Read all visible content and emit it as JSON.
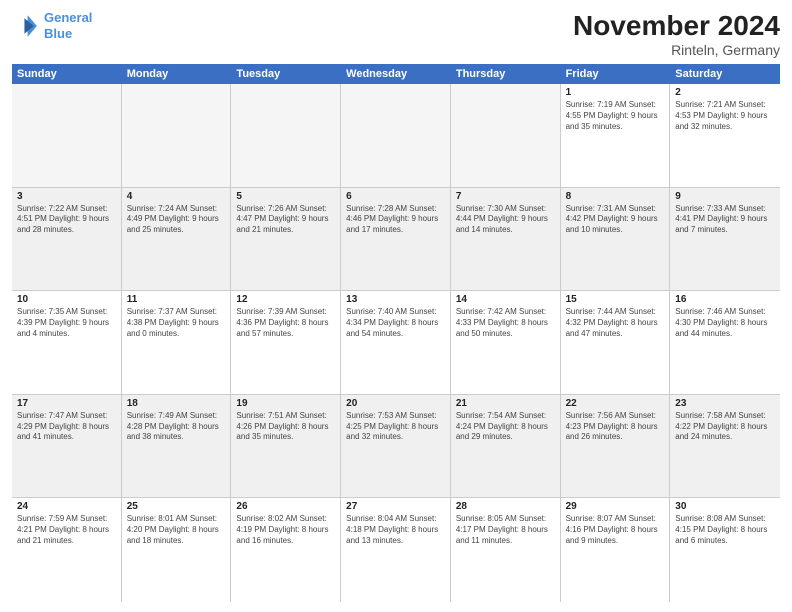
{
  "header": {
    "logo_line1": "General",
    "logo_line2": "Blue",
    "title": "November 2024",
    "location": "Rinteln, Germany"
  },
  "calendar": {
    "days_of_week": [
      "Sunday",
      "Monday",
      "Tuesday",
      "Wednesday",
      "Thursday",
      "Friday",
      "Saturday"
    ],
    "weeks": [
      [
        {
          "day": "",
          "info": "",
          "empty": true
        },
        {
          "day": "",
          "info": "",
          "empty": true
        },
        {
          "day": "",
          "info": "",
          "empty": true
        },
        {
          "day": "",
          "info": "",
          "empty": true
        },
        {
          "day": "",
          "info": "",
          "empty": true
        },
        {
          "day": "1",
          "info": "Sunrise: 7:19 AM\nSunset: 4:55 PM\nDaylight: 9 hours and 35 minutes.",
          "empty": false
        },
        {
          "day": "2",
          "info": "Sunrise: 7:21 AM\nSunset: 4:53 PM\nDaylight: 9 hours and 32 minutes.",
          "empty": false
        }
      ],
      [
        {
          "day": "3",
          "info": "Sunrise: 7:22 AM\nSunset: 4:51 PM\nDaylight: 9 hours and 28 minutes.",
          "empty": false
        },
        {
          "day": "4",
          "info": "Sunrise: 7:24 AM\nSunset: 4:49 PM\nDaylight: 9 hours and 25 minutes.",
          "empty": false
        },
        {
          "day": "5",
          "info": "Sunrise: 7:26 AM\nSunset: 4:47 PM\nDaylight: 9 hours and 21 minutes.",
          "empty": false
        },
        {
          "day": "6",
          "info": "Sunrise: 7:28 AM\nSunset: 4:46 PM\nDaylight: 9 hours and 17 minutes.",
          "empty": false
        },
        {
          "day": "7",
          "info": "Sunrise: 7:30 AM\nSunset: 4:44 PM\nDaylight: 9 hours and 14 minutes.",
          "empty": false
        },
        {
          "day": "8",
          "info": "Sunrise: 7:31 AM\nSunset: 4:42 PM\nDaylight: 9 hours and 10 minutes.",
          "empty": false
        },
        {
          "day": "9",
          "info": "Sunrise: 7:33 AM\nSunset: 4:41 PM\nDaylight: 9 hours and 7 minutes.",
          "empty": false
        }
      ],
      [
        {
          "day": "10",
          "info": "Sunrise: 7:35 AM\nSunset: 4:39 PM\nDaylight: 9 hours and 4 minutes.",
          "empty": false
        },
        {
          "day": "11",
          "info": "Sunrise: 7:37 AM\nSunset: 4:38 PM\nDaylight: 9 hours and 0 minutes.",
          "empty": false
        },
        {
          "day": "12",
          "info": "Sunrise: 7:39 AM\nSunset: 4:36 PM\nDaylight: 8 hours and 57 minutes.",
          "empty": false
        },
        {
          "day": "13",
          "info": "Sunrise: 7:40 AM\nSunset: 4:34 PM\nDaylight: 8 hours and 54 minutes.",
          "empty": false
        },
        {
          "day": "14",
          "info": "Sunrise: 7:42 AM\nSunset: 4:33 PM\nDaylight: 8 hours and 50 minutes.",
          "empty": false
        },
        {
          "day": "15",
          "info": "Sunrise: 7:44 AM\nSunset: 4:32 PM\nDaylight: 8 hours and 47 minutes.",
          "empty": false
        },
        {
          "day": "16",
          "info": "Sunrise: 7:46 AM\nSunset: 4:30 PM\nDaylight: 8 hours and 44 minutes.",
          "empty": false
        }
      ],
      [
        {
          "day": "17",
          "info": "Sunrise: 7:47 AM\nSunset: 4:29 PM\nDaylight: 8 hours and 41 minutes.",
          "empty": false
        },
        {
          "day": "18",
          "info": "Sunrise: 7:49 AM\nSunset: 4:28 PM\nDaylight: 8 hours and 38 minutes.",
          "empty": false
        },
        {
          "day": "19",
          "info": "Sunrise: 7:51 AM\nSunset: 4:26 PM\nDaylight: 8 hours and 35 minutes.",
          "empty": false
        },
        {
          "day": "20",
          "info": "Sunrise: 7:53 AM\nSunset: 4:25 PM\nDaylight: 8 hours and 32 minutes.",
          "empty": false
        },
        {
          "day": "21",
          "info": "Sunrise: 7:54 AM\nSunset: 4:24 PM\nDaylight: 8 hours and 29 minutes.",
          "empty": false
        },
        {
          "day": "22",
          "info": "Sunrise: 7:56 AM\nSunset: 4:23 PM\nDaylight: 8 hours and 26 minutes.",
          "empty": false
        },
        {
          "day": "23",
          "info": "Sunrise: 7:58 AM\nSunset: 4:22 PM\nDaylight: 8 hours and 24 minutes.",
          "empty": false
        }
      ],
      [
        {
          "day": "24",
          "info": "Sunrise: 7:59 AM\nSunset: 4:21 PM\nDaylight: 8 hours and 21 minutes.",
          "empty": false
        },
        {
          "day": "25",
          "info": "Sunrise: 8:01 AM\nSunset: 4:20 PM\nDaylight: 8 hours and 18 minutes.",
          "empty": false
        },
        {
          "day": "26",
          "info": "Sunrise: 8:02 AM\nSunset: 4:19 PM\nDaylight: 8 hours and 16 minutes.",
          "empty": false
        },
        {
          "day": "27",
          "info": "Sunrise: 8:04 AM\nSunset: 4:18 PM\nDaylight: 8 hours and 13 minutes.",
          "empty": false
        },
        {
          "day": "28",
          "info": "Sunrise: 8:05 AM\nSunset: 4:17 PM\nDaylight: 8 hours and 11 minutes.",
          "empty": false
        },
        {
          "day": "29",
          "info": "Sunrise: 8:07 AM\nSunset: 4:16 PM\nDaylight: 8 hours and 9 minutes.",
          "empty": false
        },
        {
          "day": "30",
          "info": "Sunrise: 8:08 AM\nSunset: 4:15 PM\nDaylight: 8 hours and 6 minutes.",
          "empty": false
        }
      ]
    ]
  }
}
